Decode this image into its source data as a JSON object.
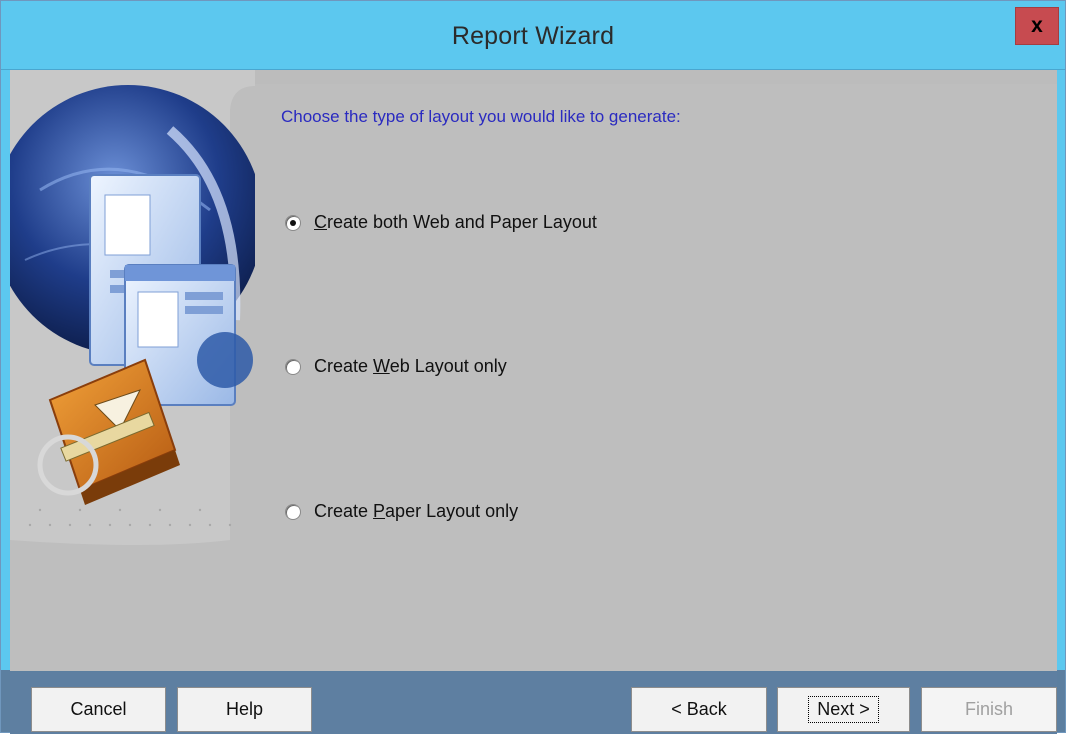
{
  "window": {
    "title": "Report Wizard",
    "close_label": "x"
  },
  "main": {
    "prompt": "Choose the type of layout you would like to generate:",
    "options": [
      {
        "pre": "",
        "accel": "C",
        "post": "reate both Web and Paper Layout",
        "checked": true
      },
      {
        "pre": "Create ",
        "accel": "W",
        "post": "eb Layout only",
        "checked": false
      },
      {
        "pre": "Create ",
        "accel": "P",
        "post": "aper Layout only",
        "checked": false
      }
    ]
  },
  "buttons": {
    "cancel": "Cancel",
    "help": "Help",
    "back": "< Back",
    "next": "Next >",
    "finish": "Finish"
  },
  "colors": {
    "titlebar": "#5cc8ef",
    "close": "#c74b50",
    "prompt_text": "#2a2ac0",
    "footer": "#5e7fa1"
  }
}
